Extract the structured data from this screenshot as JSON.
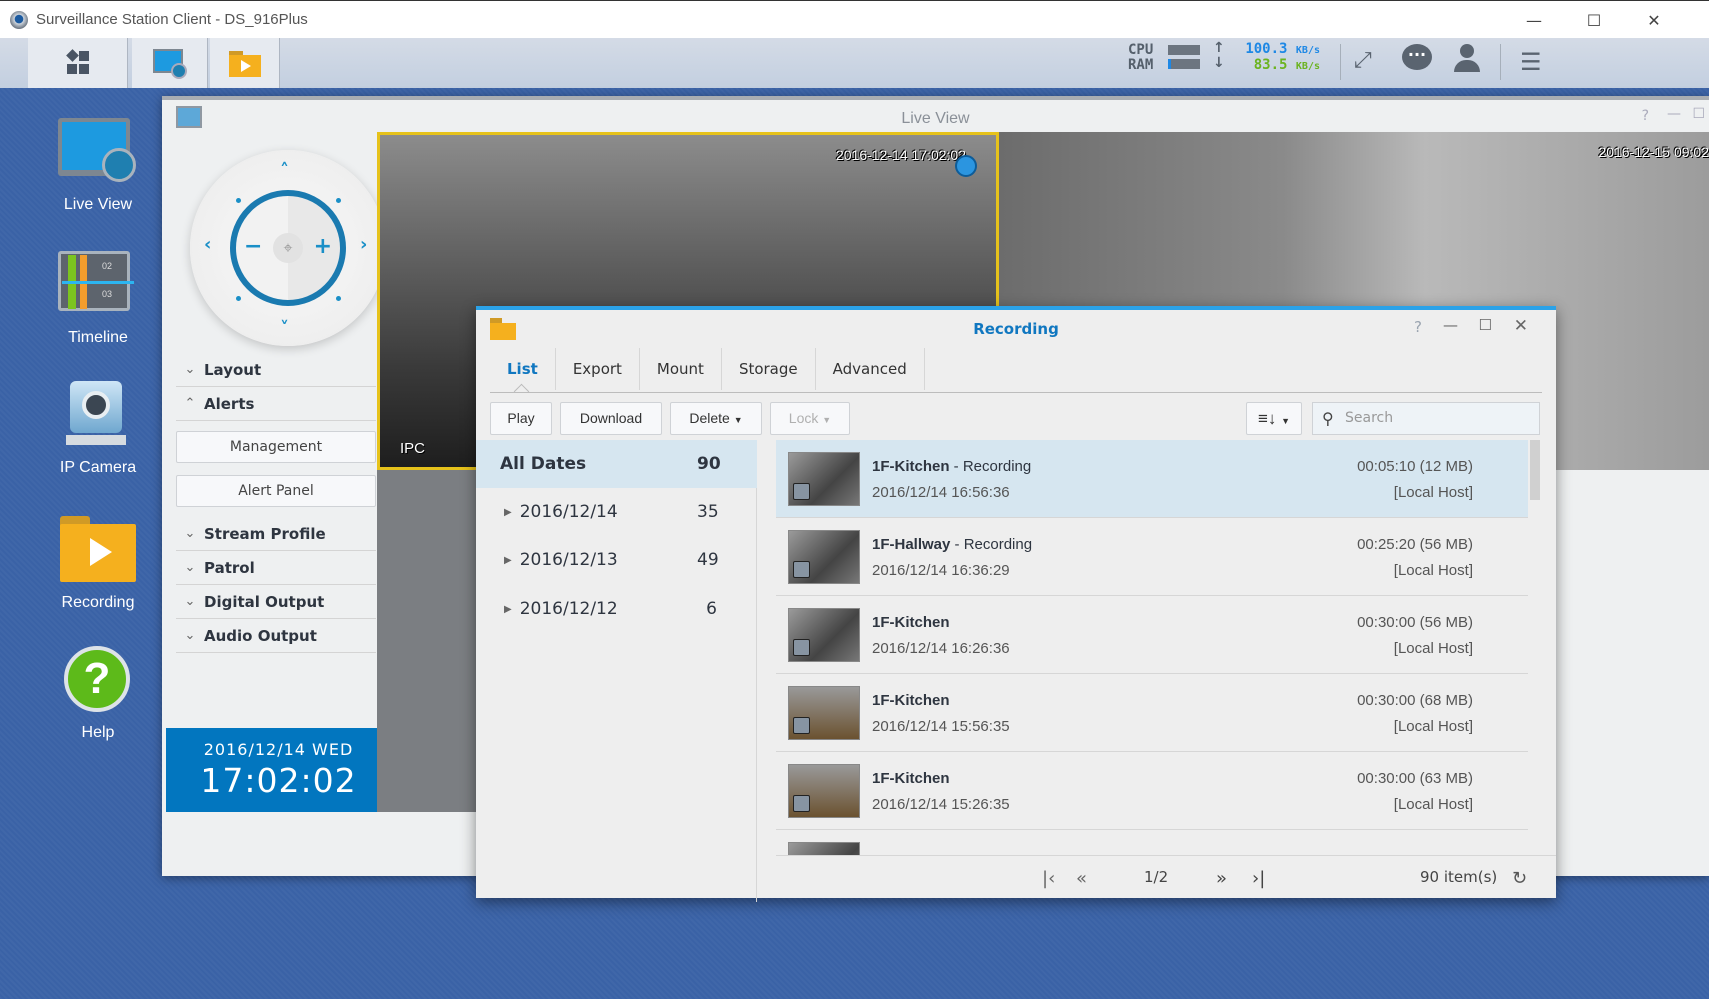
{
  "window": {
    "title": "Surveillance Station Client - DS_916Plus",
    "controls": [
      "minimize",
      "maximize",
      "close"
    ]
  },
  "toolbar": {
    "tabs": [
      {
        "name": "main-menu",
        "icon": "grid-icon"
      },
      {
        "name": "live-view",
        "icon": "live-view-icon"
      },
      {
        "name": "recording",
        "icon": "recording-folder-icon"
      }
    ],
    "cpu_label": "CPU",
    "ram_label": "RAM",
    "cpu_usage": 0.0,
    "ram_usage": 0.05,
    "upload": "100.3",
    "download": "83.5",
    "unit": "KB/s",
    "upload_color": "#1e88e5",
    "download_color": "#6bb31f"
  },
  "desktop": {
    "icons": [
      {
        "label": "Live View"
      },
      {
        "label": "Timeline",
        "ticks": [
          "02",
          "03"
        ]
      },
      {
        "label": "IP Camera"
      },
      {
        "label": "Recording"
      },
      {
        "label": "Help"
      }
    ]
  },
  "live_view": {
    "title": "Live View",
    "sections": [
      {
        "label": "Layout",
        "expanded": false
      },
      {
        "label": "Alerts",
        "expanded": true
      },
      {
        "label": "Stream Profile",
        "expanded": false
      },
      {
        "label": "Patrol",
        "expanded": false
      },
      {
        "label": "Digital Output",
        "expanded": false
      },
      {
        "label": "Audio Output",
        "expanded": false
      }
    ],
    "alert_buttons": [
      "Management",
      "Alert Panel"
    ],
    "clock": {
      "date": "2016/12/14 WED",
      "time": "17:02:02"
    },
    "cameras": [
      {
        "timestamp": "2016-12-14 17:02:02",
        "label": "IPC",
        "selected": true
      },
      {
        "timestamp": "2016-12-15 09:02"
      }
    ]
  },
  "recording": {
    "title": "Recording",
    "tabs": [
      "List",
      "Export",
      "Mount",
      "Storage",
      "Advanced"
    ],
    "active_tab": "List",
    "buttons": {
      "play": "Play",
      "download": "Download",
      "delete": "Delete",
      "lock": "Lock"
    },
    "search_placeholder": "Search",
    "dates": [
      {
        "label": "All Dates",
        "count": "90"
      },
      {
        "label": "2016/12/14",
        "count": "35"
      },
      {
        "label": "2016/12/13",
        "count": "49"
      },
      {
        "label": "2016/12/12",
        "count": "6"
      }
    ],
    "items": [
      {
        "camera": "1F-Kitchen",
        "status": " - Recording",
        "datetime": "2016/12/14 16:56:36",
        "duration": "00:05:10 (12 MB)",
        "host": "[Local Host]"
      },
      {
        "camera": "1F-Hallway",
        "status": " - Recording",
        "datetime": "2016/12/14 16:36:29",
        "duration": "00:25:20 (56 MB)",
        "host": "[Local Host]"
      },
      {
        "camera": "1F-Kitchen",
        "status": "",
        "datetime": "2016/12/14 16:26:36",
        "duration": "00:30:00 (56 MB)",
        "host": "[Local Host]"
      },
      {
        "camera": "1F-Kitchen",
        "status": "",
        "datetime": "2016/12/14 15:56:35",
        "duration": "00:30:00 (68 MB)",
        "host": "[Local Host]"
      },
      {
        "camera": "1F-Kitchen",
        "status": "",
        "datetime": "2016/12/14 15:26:35",
        "duration": "00:30:00 (63 MB)",
        "host": "[Local Host]"
      }
    ],
    "pager": {
      "page": "1/2",
      "total": "90 item(s)"
    }
  }
}
